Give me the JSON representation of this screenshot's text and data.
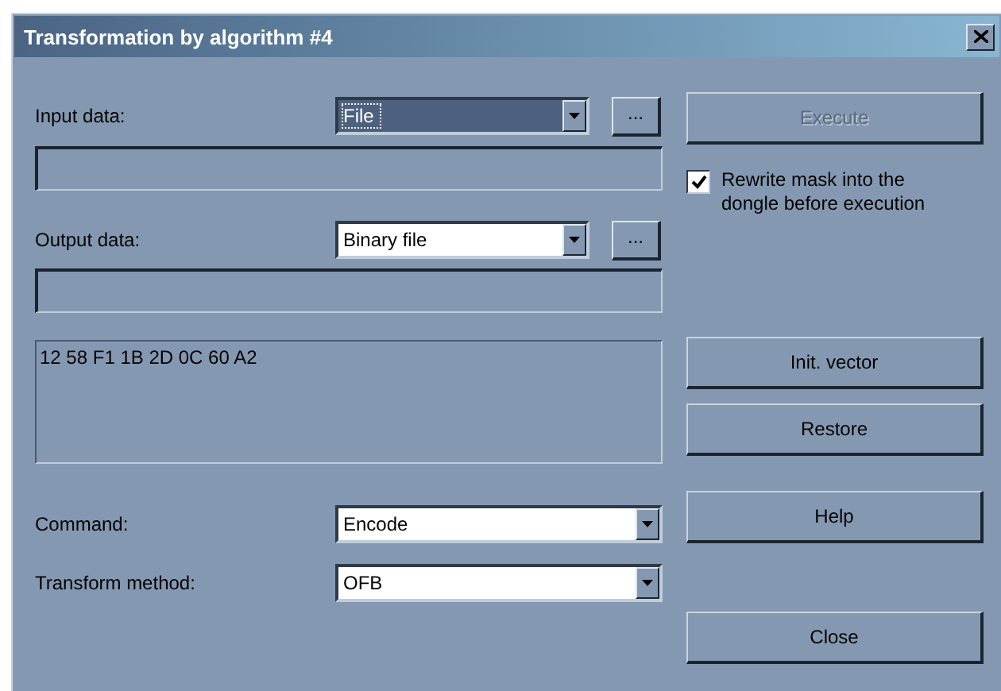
{
  "window": {
    "title": "Transformation by algorithm #4"
  },
  "input_data": {
    "label": "Input data:",
    "source": {
      "value": "File",
      "focused": true
    },
    "browse_button": "..."
  },
  "output_data": {
    "label": "Output data:",
    "source": {
      "value": "Binary file",
      "focused": false
    },
    "browse_button": "..."
  },
  "init_vector_text": "12 58 F1 1B 2D 0C 60 A2",
  "command": {
    "label": "Command:",
    "value": "Encode",
    "focused": false
  },
  "transform_method": {
    "label": "Transform method:",
    "value": "OFB",
    "focused": false
  },
  "buttons": {
    "execute": {
      "label": "Execute",
      "disabled": true
    },
    "init_vector": {
      "label": "Init. vector",
      "disabled": false
    },
    "restore": {
      "label": "Restore",
      "disabled": false
    },
    "help": {
      "label": "Help",
      "disabled": false
    },
    "close": {
      "label": "Close",
      "disabled": false
    }
  },
  "rewrite_mask": {
    "label": "Rewrite mask into the dongle before execution",
    "checked": true
  }
}
